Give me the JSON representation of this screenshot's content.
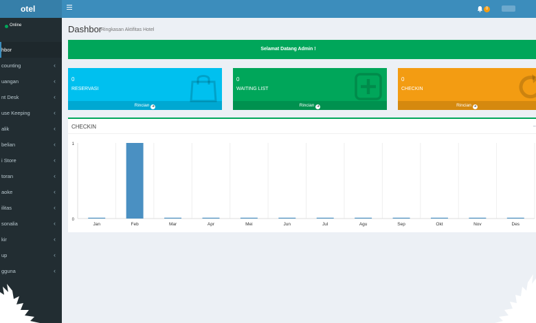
{
  "app": {
    "logo_text": "otel",
    "notifications_count": "0"
  },
  "sidebar": {
    "status": "Online",
    "items": [
      {
        "label": "hbor",
        "key": "dashbor",
        "active": true,
        "has_submenu": false
      },
      {
        "label": "counting",
        "key": "accounting",
        "active": false,
        "has_submenu": true
      },
      {
        "label": "uangan",
        "key": "keuangan",
        "active": false,
        "has_submenu": true
      },
      {
        "label": "nt Desk",
        "key": "front-desk",
        "active": false,
        "has_submenu": true
      },
      {
        "label": "use Keeping",
        "key": "house-keeping",
        "active": false,
        "has_submenu": true
      },
      {
        "label": "alik",
        "key": "logistik",
        "active": false,
        "has_submenu": true
      },
      {
        "label": "belian",
        "key": "pembelian",
        "active": false,
        "has_submenu": true
      },
      {
        "label": "i Store",
        "key": "mini-store",
        "active": false,
        "has_submenu": true
      },
      {
        "label": "toran",
        "key": "restoran",
        "active": false,
        "has_submenu": true
      },
      {
        "label": "aoke",
        "key": "karaoke",
        "active": false,
        "has_submenu": true
      },
      {
        "label": "ilitas",
        "key": "fasilitas",
        "active": false,
        "has_submenu": true
      },
      {
        "label": "sonalia",
        "key": "personalia",
        "active": false,
        "has_submenu": true
      },
      {
        "label": "kir",
        "key": "parkir",
        "active": false,
        "has_submenu": true
      },
      {
        "label": "up",
        "key": "backup",
        "active": false,
        "has_submenu": true
      },
      {
        "label": "gguna",
        "key": "pengguna",
        "active": false,
        "has_submenu": true
      }
    ]
  },
  "page": {
    "title": "Dashbor",
    "subtitle": "Ringkasan Aktifitas Hotel",
    "welcome": "Selamat Datang Admin !"
  },
  "cards": [
    {
      "key": "reservasi",
      "value": "0",
      "label": "RESERVASI",
      "footer": "Rincian",
      "color": "#00c0ef",
      "icon": "shopping-bag-icon"
    },
    {
      "key": "waiting",
      "value": "0",
      "label": "WAITING LIST",
      "footer": "Rincian",
      "color": "#00a65a",
      "icon": "plus-square-icon"
    },
    {
      "key": "checkin",
      "value": "0",
      "label": "CHECKIN",
      "footer": "Rincian",
      "color": "#f39c12",
      "icon": "refresh-icon"
    }
  ],
  "panel": {
    "title": "CHECKIN"
  },
  "chart_data": {
    "type": "bar",
    "categories": [
      "Jan",
      "Feb",
      "Mar",
      "Apr",
      "Mei",
      "Jun",
      "Jul",
      "Agu",
      "Sep",
      "Okt",
      "Nov",
      "Des"
    ],
    "values": [
      0,
      1,
      0,
      0,
      0,
      0,
      0,
      0,
      0,
      0,
      0,
      0
    ],
    "ylim": [
      0,
      1
    ],
    "yticks": [
      "0",
      "1"
    ],
    "grid": true,
    "bar_color": "#4a90c2"
  }
}
